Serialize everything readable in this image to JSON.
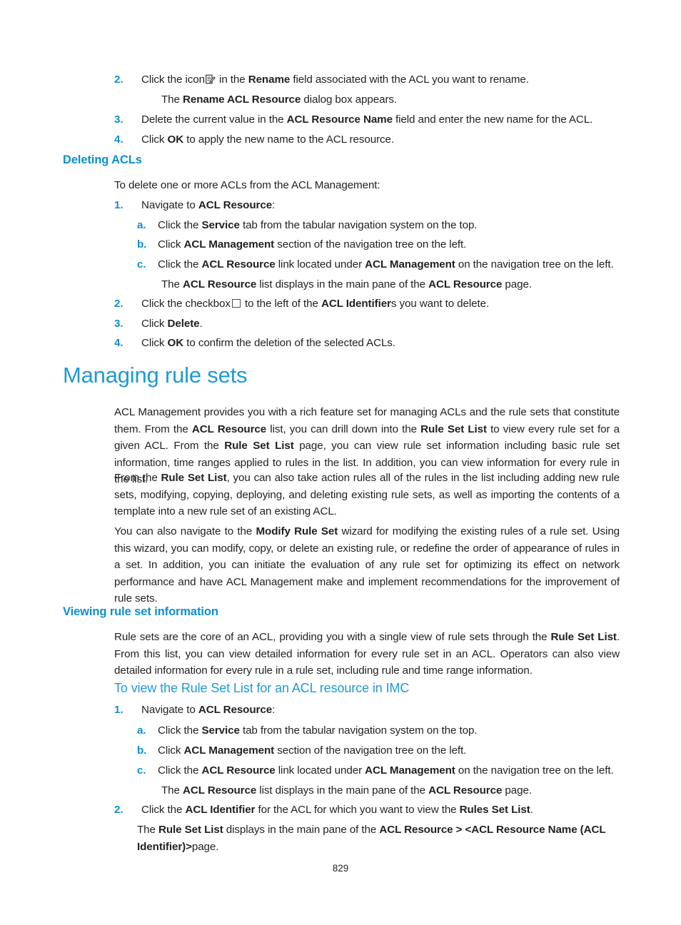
{
  "document": {
    "page_number": "829",
    "accent_heading": "#0d8fd0",
    "accent_title": "#1e9ad6",
    "body_color": "#231f20"
  },
  "rename_steps": {
    "step2": {
      "marker": "2.",
      "before_icon": "Click the icon",
      "icon": "edit-rename-icon",
      "after_icon": " in the ",
      "bold1": "Rename",
      "tail": " field associated with the ACL you want to rename."
    },
    "step2_result": {
      "lead": "The ",
      "bold": "Rename ACL Resource",
      "tail": " dialog box appears."
    },
    "step3": {
      "marker": "3.",
      "lead": "Delete the current value in the ",
      "bold": "ACL Resource Name",
      "tail": " field and enter the new name for the ACL."
    },
    "step4": {
      "marker": "4.",
      "lead": "Click ",
      "bold": "OK",
      "tail": " to apply the new name to the ACL resource."
    }
  },
  "deleting_acls": {
    "heading": "Deleting ACLs",
    "intro": "To delete one or more ACLs from the ACL Management:",
    "step1": {
      "marker": "1.",
      "lead": "Navigate to ",
      "bold": "ACL Resource",
      "tail": ":"
    },
    "step1a": {
      "marker": "a.",
      "lead": "Click the ",
      "bold": "Service",
      "tail": " tab from the tabular navigation system on the top."
    },
    "step1b": {
      "marker": "b.",
      "lead": "Click ",
      "bold": "ACL Management",
      "tail": " section of the navigation tree on the left."
    },
    "step1c": {
      "marker": "c.",
      "lead": "Click the ",
      "bold1": "ACL Resource",
      "mid": " link located under ",
      "bold2": "ACL Management",
      "tail": " on the navigation tree on the left."
    },
    "step1c_result": {
      "lead": "The ",
      "bold1": "ACL Resource",
      "mid": " list displays in the main pane of the ",
      "bold2": "ACL Resource",
      "tail": " page."
    },
    "step2": {
      "marker": "2.",
      "lead": "Click the checkbox",
      "icon": "checkbox-icon",
      "mid": " to the left of the ",
      "bold": "ACL Identifier",
      "tail": "s you want to delete."
    },
    "step3": {
      "marker": "3.",
      "lead": "Click ",
      "bold": "Delete",
      "tail": "."
    },
    "step4": {
      "marker": "4.",
      "lead": "Click ",
      "bold": "OK",
      "tail": " to confirm the deletion of the selected ACLs."
    }
  },
  "managing_rule_sets": {
    "title": "Managing rule sets",
    "para1": {
      "t1": "ACL Management provides you with a rich feature set for managing ACLs and the rule sets that constitute them. From the ",
      "b1": "ACL Resource",
      "t2": " list, you can drill down into the ",
      "b2": "Rule Set List",
      "t3": " to view every rule set for a given ACL. From the ",
      "b3": "Rule Set List",
      "t4": " page, you can view rule set information including basic rule set information, time ranges applied to rules in the list. In addition, you can view information for every rule in the list."
    },
    "para2": {
      "t1": "From the ",
      "b1": "Rule Set List",
      "t2": ", you can also take action rules all of the rules in the list including adding new rule sets, modifying, copying, deploying, and deleting existing rule sets, as well as importing the contents of a template into a new rule set of an existing ACL."
    },
    "para3": {
      "t1": "You can also navigate to the ",
      "b1": "Modify Rule Set",
      "t2": " wizard for modifying the existing rules of a rule set. Using this wizard, you can modify, copy, or delete an existing rule, or redefine the order of appearance of rules in a set. In addition, you can initiate the evaluation of any rule set for optimizing its effect on network performance and have ACL Management make and implement recommendations for the improvement of rule sets."
    }
  },
  "viewing_rule_set_information": {
    "heading": "Viewing rule set information",
    "para1": {
      "t1": "Rule sets are the core of an ACL, providing you with a single view of rule sets through the ",
      "b1": "Rule Set List",
      "t2": ". From this list, you can view detailed information for every rule set in an ACL. Operators can also view detailed information for every rule in a rule set, including rule and time range information."
    },
    "subheading": "To view the Rule Set List for an ACL resource in IMC",
    "step1": {
      "marker": "1.",
      "lead": "Navigate to ",
      "bold": "ACL Resource",
      "tail": ":"
    },
    "step1a": {
      "marker": "a.",
      "lead": "Click the ",
      "bold": "Service",
      "tail": " tab from the tabular navigation system on the top."
    },
    "step1b": {
      "marker": "b.",
      "lead": "Click ",
      "bold": "ACL Management",
      "tail": " section of the navigation tree on the left."
    },
    "step1c": {
      "marker": "c.",
      "lead": "Click the ",
      "bold1": "ACL Resource",
      "mid": " link located under ",
      "bold2": "ACL Management",
      "tail": " on the navigation tree on the left."
    },
    "step1c_result": {
      "lead": "The ",
      "bold1": "ACL Resource",
      "mid": " list displays in the main pane of the ",
      "bold2": "ACL Resource",
      "tail": " page."
    },
    "step2": {
      "marker": "2.",
      "lead": "Click the ",
      "bold1": "ACL Identifier",
      "mid": " for the ACL for which you want to view the ",
      "bold2": "Rules Set List",
      "tail": "."
    },
    "step2_result": {
      "lead": "The ",
      "bold1": "Rule Set List",
      "mid": " displays in the main pane of the ",
      "bold2": "ACL Resource > <ACL Resource Name (ACL Identifier)>",
      "tail": "page."
    }
  }
}
